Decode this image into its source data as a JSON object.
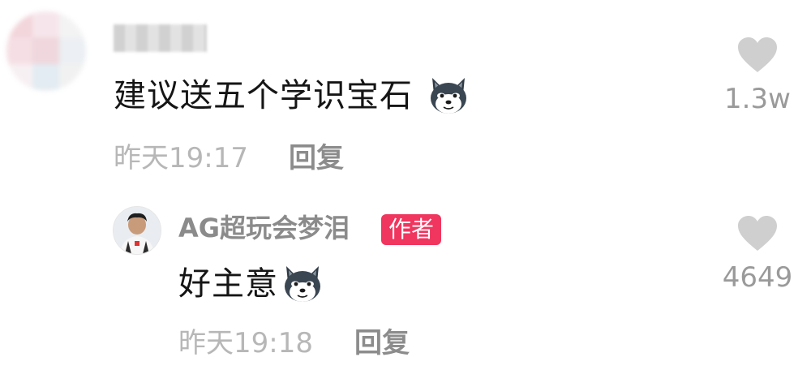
{
  "comment": {
    "text": "建议送五个学识宝石",
    "emoji": "dog-emoji",
    "time": "昨天19:17",
    "reply_label": "回复",
    "like_icon": "heart-icon",
    "like_count": "1.3w"
  },
  "reply": {
    "username": "AG超玩会梦泪",
    "badge": "作者",
    "text": "好主意",
    "emoji": "dog-emoji",
    "time": "昨天19:18",
    "reply_label": "回复",
    "like_icon": "heart-icon",
    "like_count": "4649"
  },
  "colors": {
    "badge": "#f0355e",
    "heart": "#cfcfcf",
    "time": "#b7b7b7",
    "reply_btn": "#8c8c8c"
  }
}
